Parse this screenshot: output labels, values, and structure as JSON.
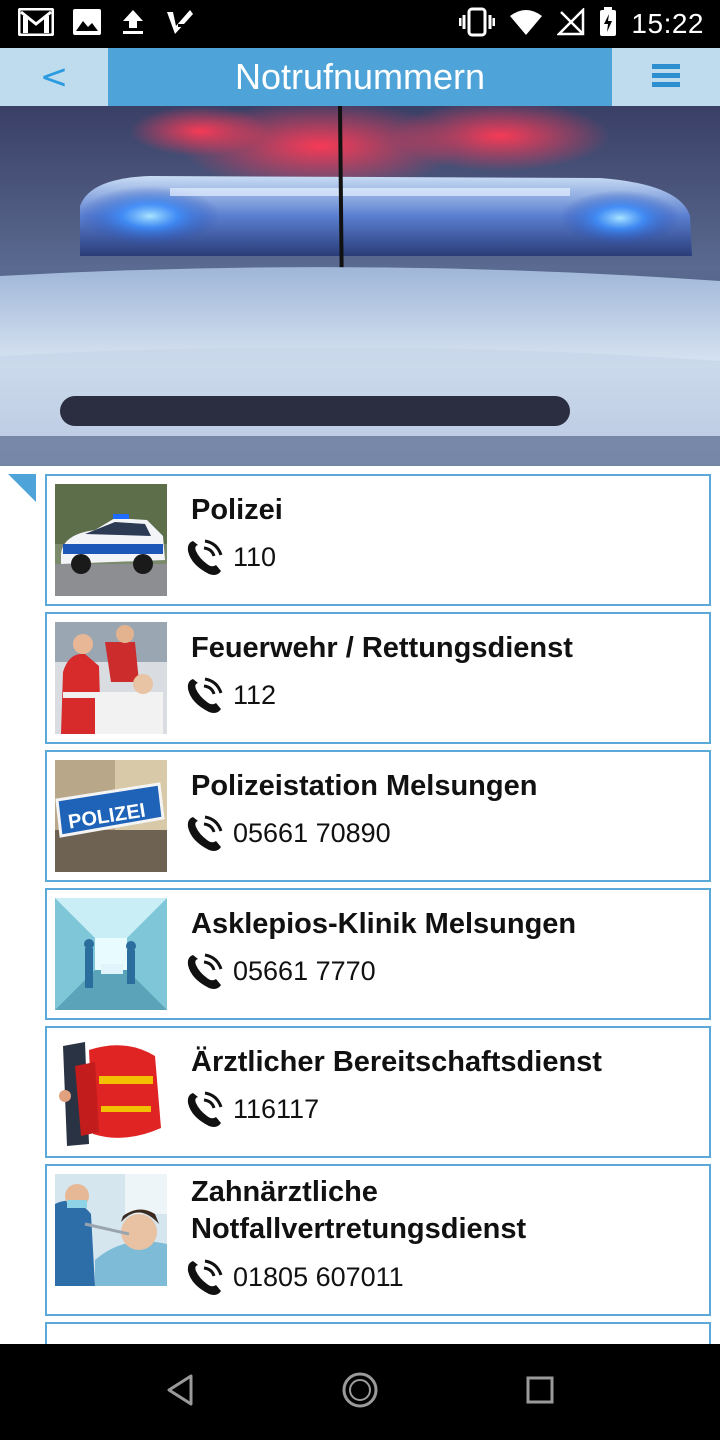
{
  "status_bar": {
    "time": "15:22",
    "left_icons": [
      "gmail-icon",
      "image-icon",
      "upload-icon",
      "check-app-icon"
    ],
    "right_icons": [
      "vibrate-icon",
      "wifi-icon",
      "no-signal-icon",
      "battery-charging-icon"
    ]
  },
  "header": {
    "back_label": "<",
    "title": "Notrufnummern",
    "menu_icon": "hamburger-menu-icon"
  },
  "hero": {
    "image": "police-car-lightbar-photo"
  },
  "contacts": [
    {
      "name": "Polizei",
      "phone": "110",
      "thumb": "police-car-photo"
    },
    {
      "name": "Feuerwehr / Rettungsdienst",
      "phone": "112",
      "thumb": "paramedics-photo"
    },
    {
      "name": "Polizeistation Melsungen",
      "phone": "05661 70890",
      "thumb": "polizei-sign-photo"
    },
    {
      "name": "Asklepios-Klinik Melsungen",
      "phone": "05661 7770",
      "thumb": "hospital-corridor-photo"
    },
    {
      "name": "Ärztlicher Bereitschaftsdienst",
      "phone": "116117",
      "thumb": "medical-backpack-photo"
    },
    {
      "name": "Zahnärztliche Notfallvertretungsdienst",
      "phone": "01805 607011",
      "thumb": "dentist-photo"
    }
  ],
  "nav_bar": {
    "buttons": [
      "back-nav-icon",
      "home-nav-icon",
      "recents-nav-icon"
    ]
  },
  "colors": {
    "accent": "#4ea4d8",
    "accent_light": "#bfdcef",
    "card_border": "#5aa9d8",
    "back_arrow": "#2b9be0"
  }
}
